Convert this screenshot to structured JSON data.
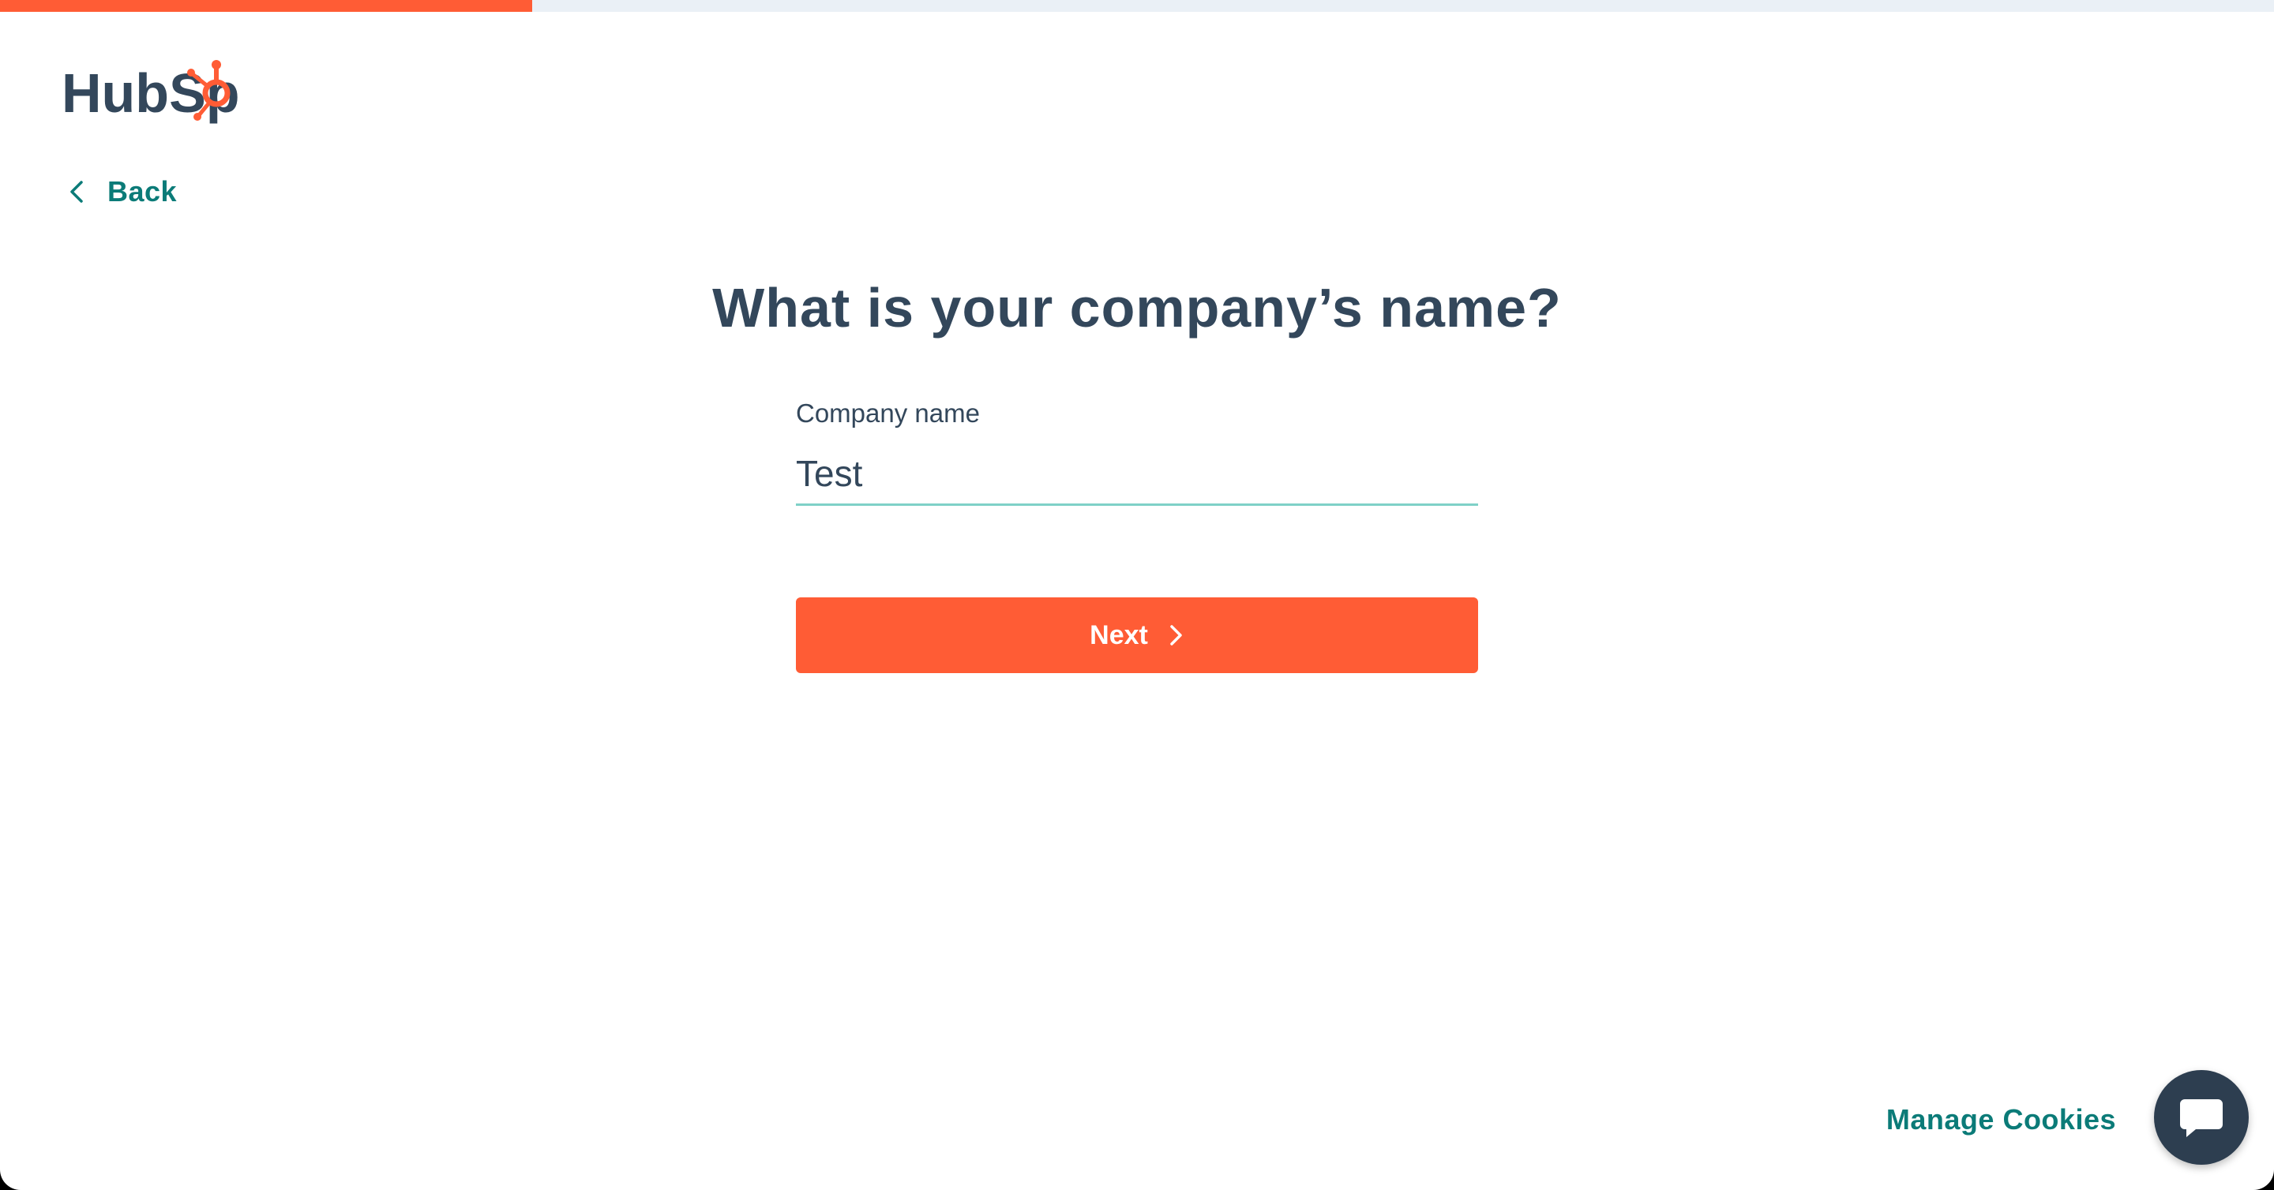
{
  "colors": {
    "accent": "#ff5c35",
    "link": "#0b7b78",
    "text": "#33475b",
    "input_underline": "#7fd1c7",
    "progress_track": "#eaf0f6",
    "chat_bg": "#2d3e50"
  },
  "progress": {
    "fraction": 0.234
  },
  "header": {
    "logo_text": "HubSpot",
    "logo_icon": "hubspot-sprocket-icon"
  },
  "nav": {
    "back_label": "Back",
    "back_icon": "chevron-left-icon"
  },
  "main": {
    "heading": "What is your company’s name?",
    "field": {
      "label": "Company name",
      "value": "Test"
    },
    "next_button": {
      "label": "Next",
      "icon": "chevron-right-icon"
    }
  },
  "footer": {
    "manage_cookies_label": "Manage Cookies",
    "chat_icon": "chat-bubble-icon"
  }
}
